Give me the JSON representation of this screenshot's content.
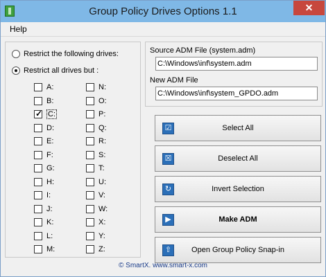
{
  "window": {
    "title": "Group Policy Drives Options 1.1",
    "close_glyph": "✕"
  },
  "menu": {
    "help": "Help"
  },
  "restrict": {
    "option_following": "Restrict the following drives:",
    "option_all_but": "Restrict all drives but :",
    "selected": "all_but"
  },
  "drives_left": [
    {
      "label": "A:",
      "checked": false
    },
    {
      "label": "B:",
      "checked": false
    },
    {
      "label": "C:",
      "checked": true
    },
    {
      "label": "D:",
      "checked": false
    },
    {
      "label": "E:",
      "checked": false
    },
    {
      "label": "F:",
      "checked": false
    },
    {
      "label": "G:",
      "checked": false
    },
    {
      "label": "H:",
      "checked": false
    },
    {
      "label": "I:",
      "checked": false
    },
    {
      "label": "J:",
      "checked": false
    },
    {
      "label": "K:",
      "checked": false
    },
    {
      "label": "L:",
      "checked": false
    },
    {
      "label": "M:",
      "checked": false
    }
  ],
  "drives_right": [
    {
      "label": "N:",
      "checked": false
    },
    {
      "label": "O:",
      "checked": false
    },
    {
      "label": "P:",
      "checked": false
    },
    {
      "label": "Q:",
      "checked": false
    },
    {
      "label": "R:",
      "checked": false
    },
    {
      "label": "S:",
      "checked": false
    },
    {
      "label": "T:",
      "checked": false
    },
    {
      "label": "U:",
      "checked": false
    },
    {
      "label": "V:",
      "checked": false
    },
    {
      "label": "W:",
      "checked": false
    },
    {
      "label": "X:",
      "checked": false
    },
    {
      "label": "Y:",
      "checked": false
    },
    {
      "label": "Z:",
      "checked": false
    }
  ],
  "files": {
    "source_label": "Source ADM File (system.adm)",
    "source_value": "C:\\Windows\\inf\\system.adm",
    "new_label": "New ADM File",
    "new_value": "C:\\Windows\\inf\\system_GPDO.adm"
  },
  "buttons": {
    "select_all": "Select All",
    "deselect_all": "Deselect All",
    "invert_selection": "Invert Selection",
    "make_adm": "Make ADM",
    "open_snapin": "Open Group Policy Snap-in"
  },
  "footer": {
    "copyright": "© SmartX. www.smart-x.com"
  },
  "colors": {
    "titlebar": "#7fb8e6",
    "close": "#c7473d",
    "icon_blue": "#2b6fb8"
  }
}
